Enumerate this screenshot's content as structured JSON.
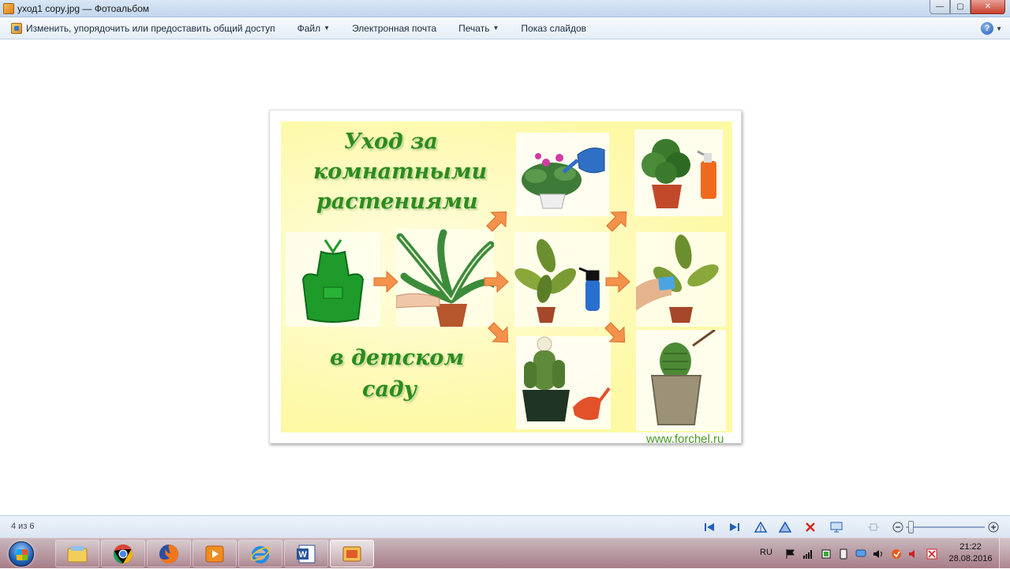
{
  "window": {
    "title": "уход1 copy.jpg — Фотоальбом",
    "buttons": {
      "minimize": "—",
      "maximize": "▢",
      "close": "✕"
    }
  },
  "menubar": {
    "organize": "Изменить, упорядочить или предоставить общий доступ",
    "file": "Файл",
    "email": "Электронная почта",
    "print": "Печать",
    "slideshow": "Показ слайдов",
    "help_icon": "?"
  },
  "photo": {
    "title_lines": [
      "Уход за",
      "комнатными",
      "растениями"
    ],
    "subtitle_lines": [
      "в детском",
      "саду"
    ],
    "watermark": "www.forchel.ru",
    "colors": {
      "background": "#fdfaa8",
      "title": "#2e8b1e",
      "arrow": "#f4924c",
      "apron": "#1e9b2a"
    }
  },
  "statusbar": {
    "count": "4 из 6",
    "controls": [
      "previous-icon",
      "next-icon",
      "rotate-left-icon",
      "rotate-right-icon",
      "delete-icon",
      "slideshow-icon",
      "fit-icon",
      "zoom-out-icon",
      "zoom-in-icon"
    ]
  },
  "taskbar": {
    "apps": [
      "explorer-icon",
      "chrome-icon",
      "firefox-icon",
      "media-player-icon",
      "ie-icon",
      "word-icon",
      "photo-viewer-icon"
    ],
    "language": "RU",
    "time": "21:22",
    "date": "28.08.2016"
  }
}
